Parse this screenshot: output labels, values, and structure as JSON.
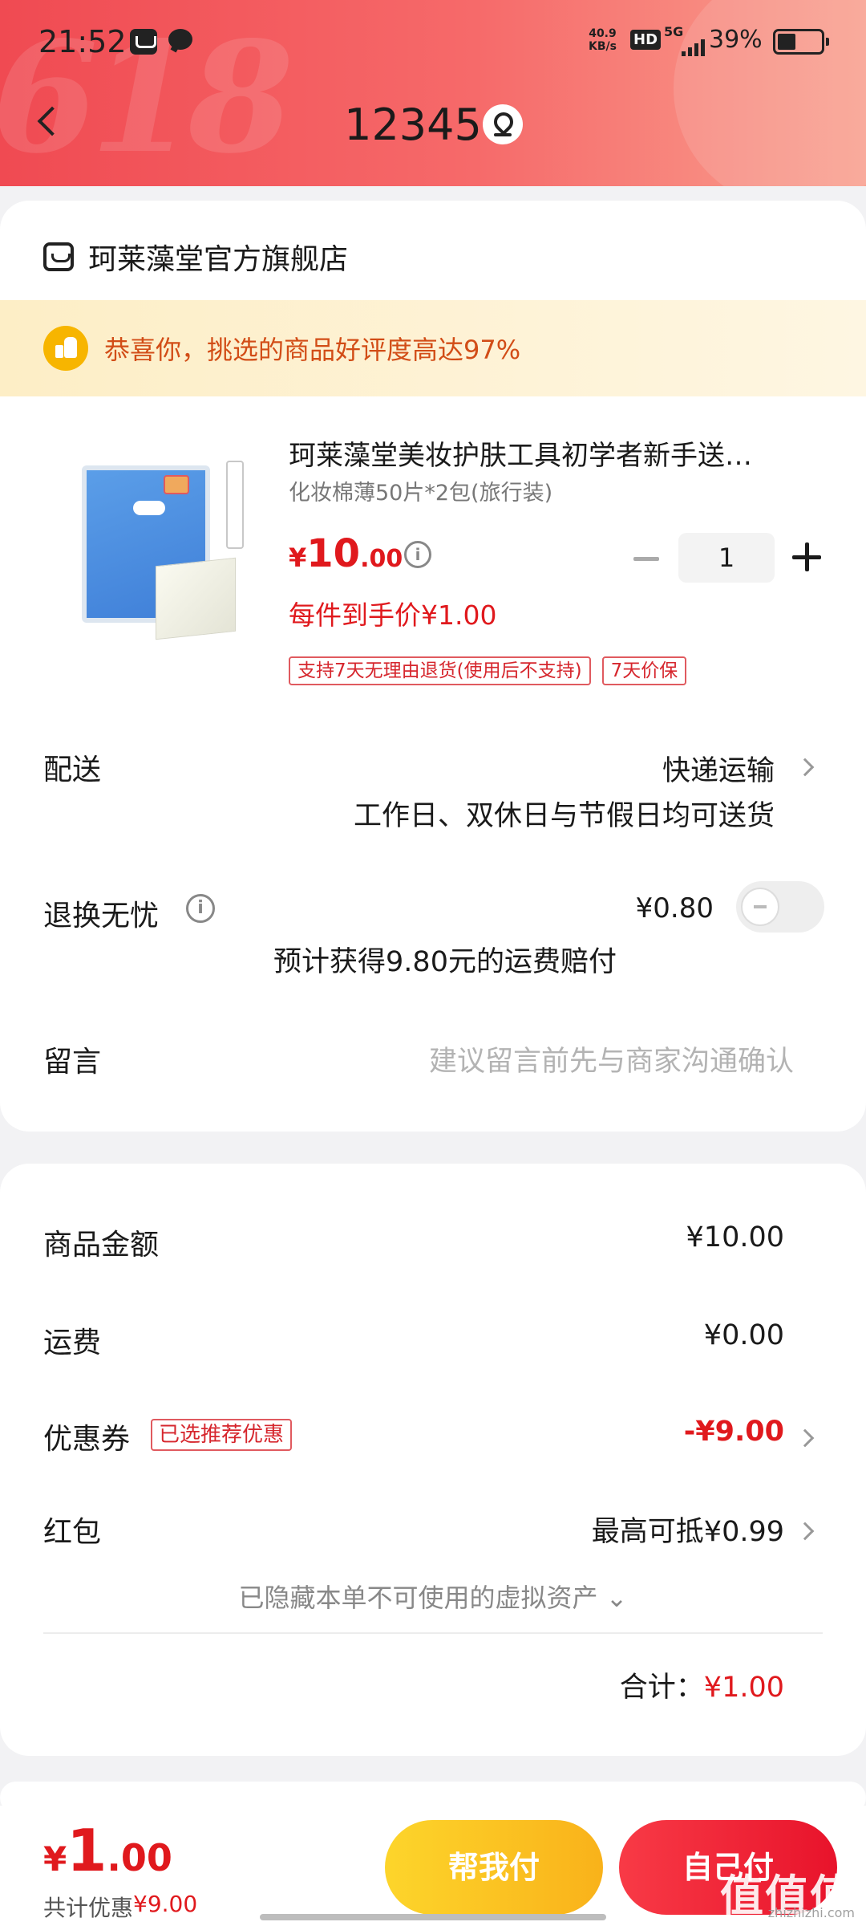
{
  "status_bar": {
    "time": "21:52",
    "net_speed_value": "40.9",
    "net_speed_unit": "KB/s",
    "hd": "HD",
    "network": "5G",
    "battery": "39%"
  },
  "header": {
    "title": "12345",
    "decoration": "618"
  },
  "store": {
    "name": "珂莱藻堂官方旗舰店"
  },
  "praise": {
    "text": "恭喜你，挑选的商品好评度高达97%"
  },
  "product": {
    "title": "珂莱藻堂美妆护肤工具初学者新手送…",
    "spec": "化妆棉薄50片*2包(旅行装)",
    "price_symbol": "¥",
    "price_int": "10",
    "price_dec": ".00",
    "quantity": "1",
    "unit_price": "每件到手价¥1.00",
    "tags": [
      "支持7天无理由退货(使用后不支持)",
      "7天价保"
    ]
  },
  "delivery": {
    "label": "配送",
    "method": "快递运输",
    "note": "工作日、双休日与节假日均可送货"
  },
  "insurance": {
    "label": "退换无忧",
    "price": "¥0.80",
    "note": "预计获得9.80元的运费赔付",
    "enabled": false
  },
  "message": {
    "label": "留言",
    "placeholder": "建议留言前先与商家沟通确认"
  },
  "fees": {
    "goods_label": "商品金额",
    "goods_value": "¥10.00",
    "shipping_label": "运费",
    "shipping_value": "¥0.00",
    "coupon_label": "优惠券",
    "coupon_badge": "已选推荐优惠",
    "coupon_value": "-¥9.00",
    "redpacket_label": "红包",
    "redpacket_value": "最高可抵¥0.99",
    "hidden_assets": "已隐藏本单不可使用的虚拟资产 ⌄",
    "total_label": "合计：",
    "total_value": "¥1.00"
  },
  "bottom": {
    "price_symbol": "¥",
    "price_int": "1",
    "price_dec": ".00",
    "saved_label": "共计优惠",
    "saved_value": "¥9.00",
    "help_pay": "帮我付",
    "self_pay": "自己付"
  },
  "watermark": {
    "main": "值值值",
    "sub": "zhizhizhi.com"
  },
  "colors": {
    "accent_red": "#e0191d",
    "header_gradient_start": "#f04a52",
    "help_pay_yellow": "#fdd52b",
    "self_pay_red": "#f83a46"
  }
}
